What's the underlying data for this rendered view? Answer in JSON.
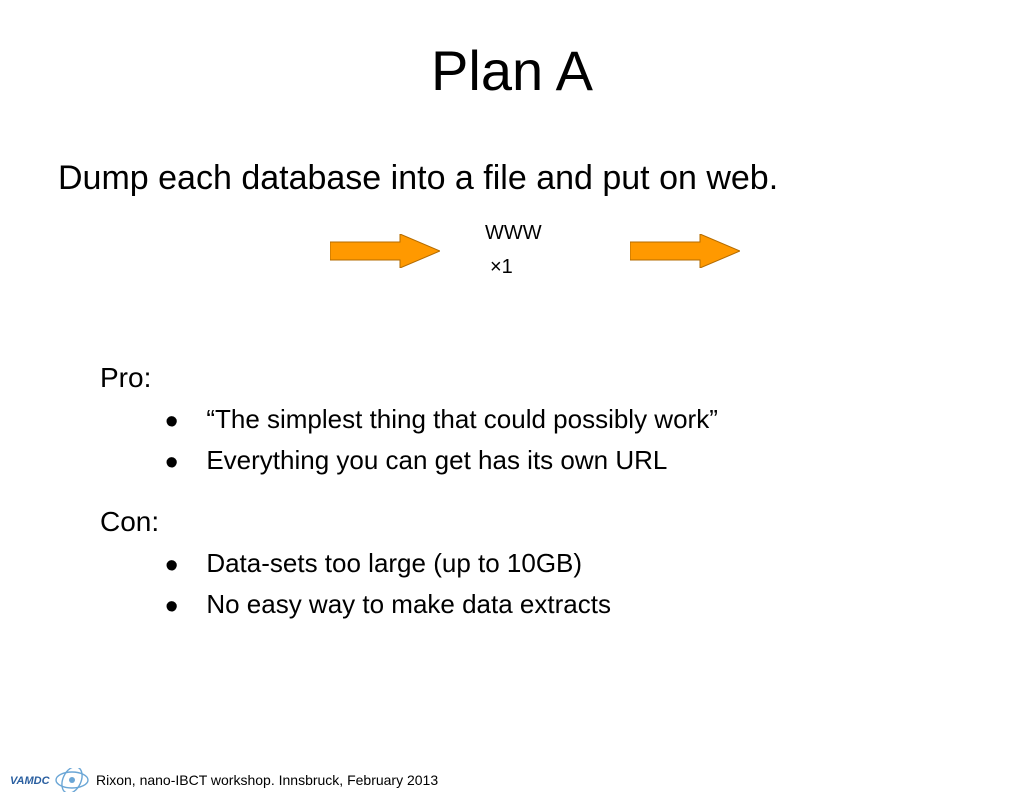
{
  "title": "Plan A",
  "subtitle": "Dump each database into a file and put on web.",
  "diagram": {
    "www_label": "WWW",
    "multiplier": "×1"
  },
  "pro": {
    "label": "Pro:",
    "items": [
      "“The simplest thing that could possibly work”",
      "Everything you can get has its own URL"
    ]
  },
  "con": {
    "label": "Con:",
    "items": [
      "Data-sets too large (up to 10GB)",
      "No easy way to make data extracts"
    ]
  },
  "footer": "Rixon, nano-IBCT workshop. Innsbruck, February 2013",
  "logo_text": "VAMDC"
}
